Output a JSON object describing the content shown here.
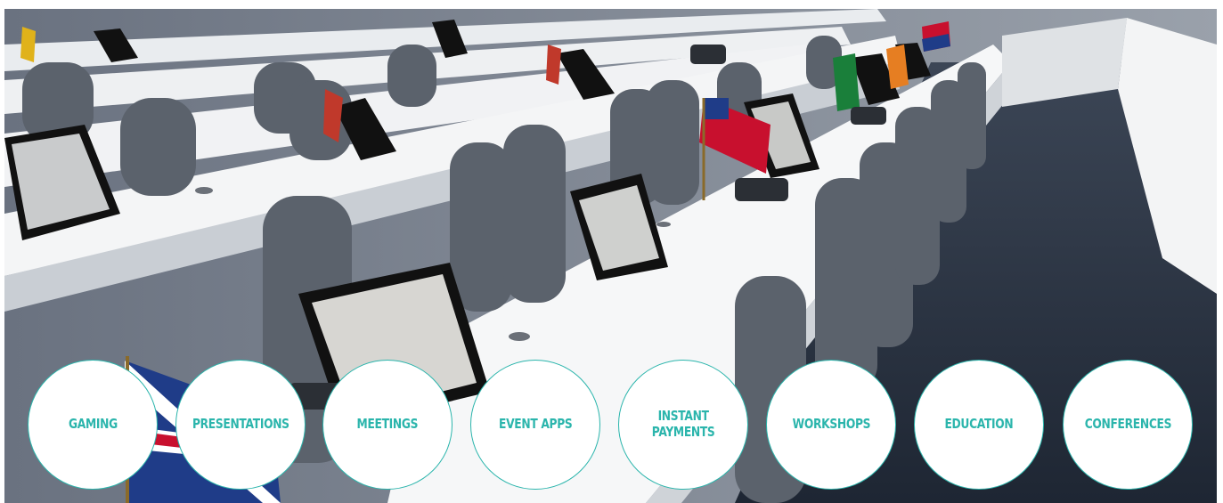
{
  "hero": {
    "image_icon": "conference-room-photo",
    "accent_color": "#2bb5ac"
  },
  "categories": [
    {
      "label": "GAMING"
    },
    {
      "label": "PRESENTATIONS"
    },
    {
      "label": "MEETINGS"
    },
    {
      "label": "EVENT APPS"
    },
    {
      "label": "INSTANT\nPAYMENTS"
    },
    {
      "label": "WORKSHOPS"
    },
    {
      "label": "EDUCATION"
    },
    {
      "label": "CONFERENCES"
    }
  ]
}
